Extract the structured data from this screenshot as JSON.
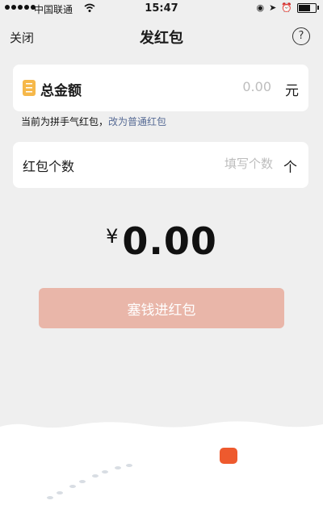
{
  "status_bar": {
    "carrier": "中国联通",
    "time": "15:47"
  },
  "nav": {
    "close_label": "关闭",
    "title": "发红包",
    "help_icon": "question-circle-icon"
  },
  "amount": {
    "label": "总金额",
    "value": "0.00",
    "unit": "元",
    "icon": "coin-icon"
  },
  "mode_note": {
    "prefix": "当前为拼手气红包，",
    "link": "改为普通红包"
  },
  "count": {
    "label": "红包个数",
    "placeholder": "填写个数",
    "unit": "个"
  },
  "total": {
    "currency": "¥",
    "value": "0.00"
  },
  "submit_label": "塞钱进红包",
  "colors": {
    "accent_button": "#e9b6a9",
    "link": "#576b95",
    "icon_gold": "#f6b84a",
    "lantern": "#ee5a2e"
  }
}
